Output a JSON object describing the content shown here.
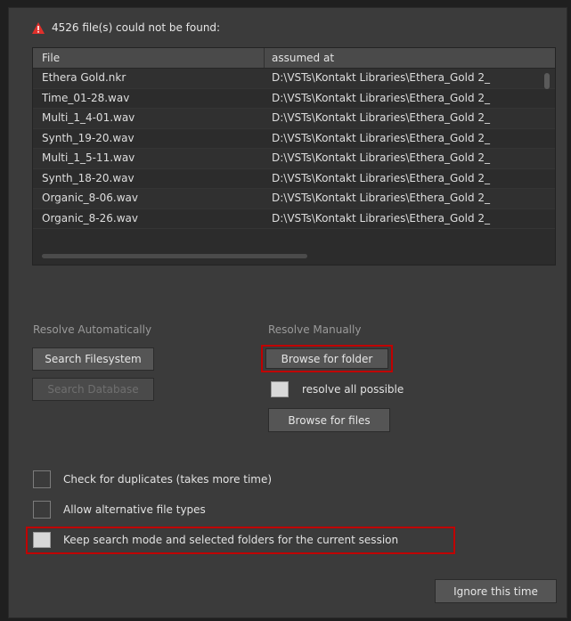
{
  "header": {
    "warning_text": "4526 file(s) could not be found:"
  },
  "table": {
    "columns": [
      "File",
      "assumed at"
    ],
    "rows": [
      {
        "file": "Ethera Gold.nkr",
        "path": "D:\\VSTs\\Kontakt Libraries\\Ethera_Gold 2_"
      },
      {
        "file": "Time_01-28.wav",
        "path": "D:\\VSTs\\Kontakt Libraries\\Ethera_Gold 2_"
      },
      {
        "file": "Multi_1_4-01.wav",
        "path": "D:\\VSTs\\Kontakt Libraries\\Ethera_Gold 2_"
      },
      {
        "file": "Synth_19-20.wav",
        "path": "D:\\VSTs\\Kontakt Libraries\\Ethera_Gold 2_"
      },
      {
        "file": "Multi_1_5-11.wav",
        "path": "D:\\VSTs\\Kontakt Libraries\\Ethera_Gold 2_"
      },
      {
        "file": "Synth_18-20.wav",
        "path": "D:\\VSTs\\Kontakt Libraries\\Ethera_Gold 2_"
      },
      {
        "file": "Organic_8-06.wav",
        "path": "D:\\VSTs\\Kontakt Libraries\\Ethera_Gold 2_"
      },
      {
        "file": "Organic_8-26.wav",
        "path": "D:\\VSTs\\Kontakt Libraries\\Ethera_Gold 2_"
      }
    ]
  },
  "resolve_auto": {
    "label": "Resolve Automatically",
    "search_filesystem": "Search Filesystem",
    "search_database": "Search Database"
  },
  "resolve_manual": {
    "label": "Resolve Manually",
    "browse_folder": "Browse for folder",
    "resolve_all_possible": "resolve all possible",
    "browse_files": "Browse for files"
  },
  "options": {
    "check_duplicates": "Check for duplicates (takes more time)",
    "allow_alt_types": "Allow alternative file types",
    "keep_search_mode": "Keep search mode and selected folders for the current session"
  },
  "footer": {
    "ignore": "Ignore this time"
  },
  "colors": {
    "warning": "#e0302b",
    "highlight": "#c00000",
    "panel": "#3b3b3b"
  },
  "icons": {
    "warning": "warning-triangle-icon"
  }
}
